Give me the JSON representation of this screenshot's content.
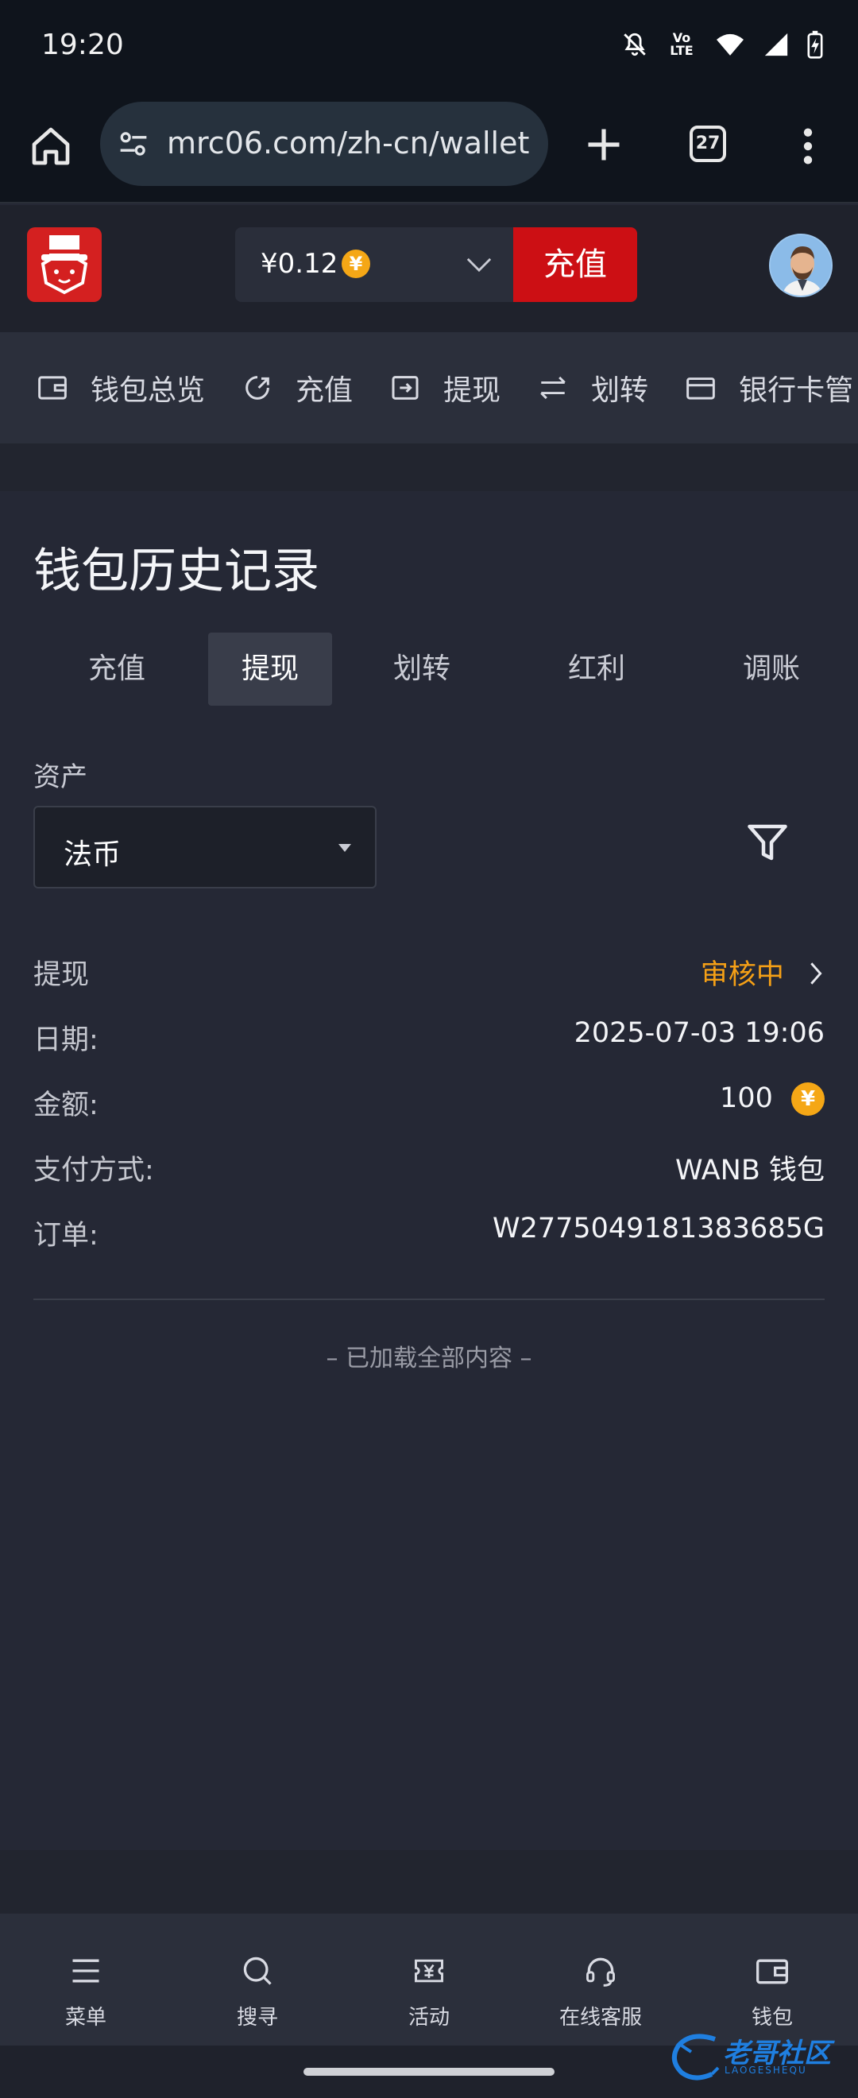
{
  "status_bar": {
    "time": "19:20",
    "lte": "Vo LTE"
  },
  "browser": {
    "url": "mrc06.com/zh-cn/wallet",
    "tab_count": "27"
  },
  "header": {
    "balance": "¥0.12",
    "coin_symbol": "¥",
    "deposit_label": "充值"
  },
  "wallet_nav": [
    {
      "label": "钱包总览",
      "icon": "wallet-icon"
    },
    {
      "label": "充值",
      "icon": "deposit-icon"
    },
    {
      "label": "提现",
      "icon": "withdraw-icon"
    },
    {
      "label": "划转",
      "icon": "transfer-icon"
    },
    {
      "label": "银行卡管",
      "icon": "card-icon"
    }
  ],
  "page": {
    "title": "钱包历史记录"
  },
  "tabs": [
    {
      "label": "充值",
      "active": false
    },
    {
      "label": "提现",
      "active": true
    },
    {
      "label": "划转",
      "active": false
    },
    {
      "label": "红利",
      "active": false
    },
    {
      "label": "调账",
      "active": false
    }
  ],
  "filter": {
    "asset_label": "资产",
    "asset_value": "法币"
  },
  "record": {
    "type": "提现",
    "status": "审核中",
    "date_label": "日期:",
    "date": "2025-07-03 19:06",
    "amount_label": "金额:",
    "amount": "100",
    "payment_label": "支付方式:",
    "payment": "WANB 钱包",
    "order_label": "订单:",
    "order": "W2775049181383685G"
  },
  "loaded_all": "– 已加载全部内容 –",
  "bottom_nav": [
    {
      "label": "菜单",
      "icon": "menu-icon"
    },
    {
      "label": "搜寻",
      "icon": "search-icon"
    },
    {
      "label": "活动",
      "icon": "ticket-icon"
    },
    {
      "label": "在线客服",
      "icon": "headset-icon"
    },
    {
      "label": "钱包",
      "icon": "wallet-icon"
    }
  ],
  "watermark": {
    "text": "老哥社区",
    "sub": "LAOGESHEQU"
  },
  "colors": {
    "accent": "#cc0f14",
    "pending": "#f5a016",
    "coin": "#f5a716",
    "background": "#252835"
  }
}
